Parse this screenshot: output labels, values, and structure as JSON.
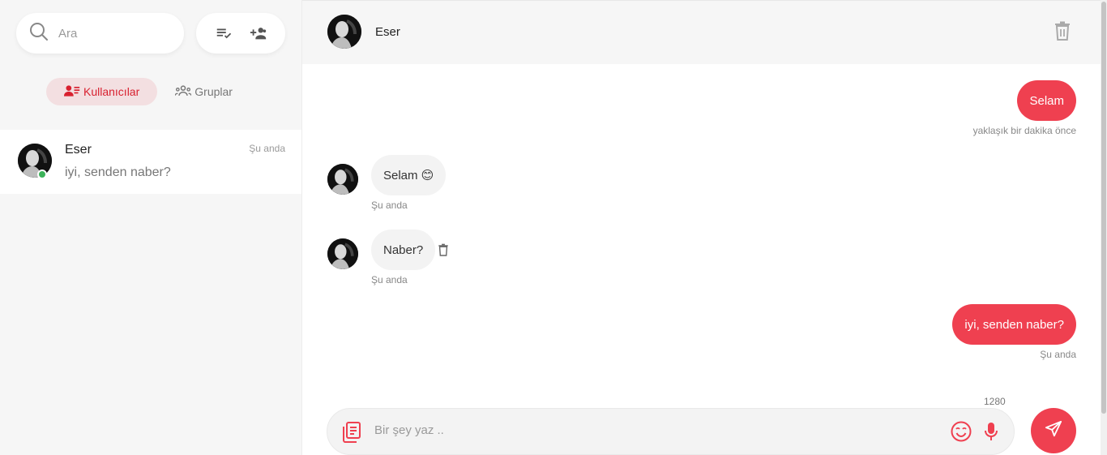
{
  "sidebar": {
    "search": {
      "placeholder": "Ara"
    },
    "tabs": [
      {
        "label": "Kullanıcılar",
        "active": true
      },
      {
        "label": "Gruplar",
        "active": false
      }
    ],
    "conversations": [
      {
        "name": "Eser",
        "last_message": "iyi, senden naber?",
        "time": "Şu anda",
        "online": true
      }
    ]
  },
  "chat": {
    "header": {
      "name": "Eser"
    },
    "messages": [
      {
        "direction": "out",
        "text": "Selam",
        "meta": "yaklaşık bir dakika önce"
      },
      {
        "direction": "in",
        "text": "Selam 😊",
        "meta": "Şu anda"
      },
      {
        "direction": "in",
        "text": "Naber?",
        "meta": "Şu anda"
      },
      {
        "direction": "out",
        "text": "iyi, senden naber?",
        "meta": "Şu anda"
      }
    ],
    "composer": {
      "placeholder": "Bir şey yaz ..",
      "char_limit": "1280"
    }
  },
  "colors": {
    "accent": "#ef4050",
    "tab_active_bg": "#f3dfe1",
    "tab_active_text": "#d8202f",
    "online": "#3cb35a"
  },
  "icons": {
    "search": "search-icon",
    "select_list": "playlist-check-icon",
    "add_user": "person-add-icon",
    "users": "contacts-icon",
    "groups": "groups-icon",
    "delete_chat": "trash-icon",
    "attach": "library-books-icon",
    "emoji": "emoji-icon",
    "mic": "microphone-icon",
    "send": "send-icon"
  }
}
